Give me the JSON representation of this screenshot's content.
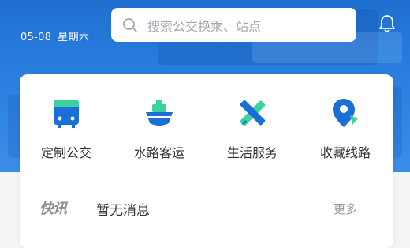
{
  "header": {
    "date": "05-08",
    "weekday": "星期六",
    "search_placeholder": "搜索公交换乘、站点"
  },
  "icons": {
    "search": "search-icon",
    "notification": "bell-icon"
  },
  "services": [
    {
      "label": "定制公交",
      "icon": "bus-icon"
    },
    {
      "label": "水路客运",
      "icon": "ship-icon"
    },
    {
      "label": "生活服务",
      "icon": "tools-icon"
    },
    {
      "label": "收藏线路",
      "icon": "route-pin-icon"
    }
  ],
  "news": {
    "logo": "快讯",
    "message": "暂无消息",
    "more_label": "更多"
  },
  "colors": {
    "hero_blue": "#2a7fe0",
    "icon_blue": "#1a6fd6",
    "icon_green": "#3ad3a0"
  }
}
